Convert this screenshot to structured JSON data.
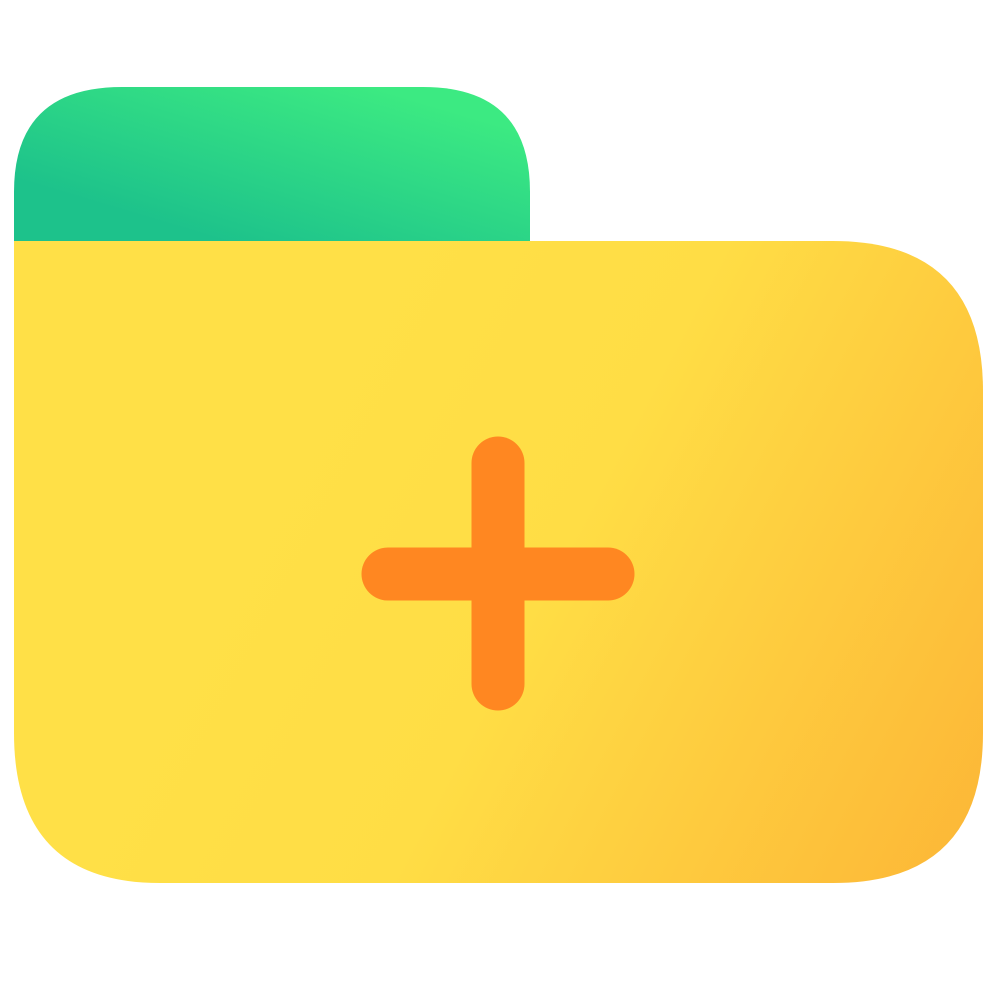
{
  "icon": {
    "name": "new-folder-icon",
    "parts": {
      "tab": "folder-tab",
      "body": "folder-body",
      "plus": "plus-icon"
    }
  },
  "colors": {
    "background": "#FFFFFF",
    "tab_gradient_start": "#1DC28B",
    "tab_gradient_end": "#3CEA82",
    "body_gradient_start": "#FFE047",
    "body_gradient_mid": "#FFDD45",
    "body_gradient_end": "#FCB235",
    "plus": "#FF8721"
  }
}
